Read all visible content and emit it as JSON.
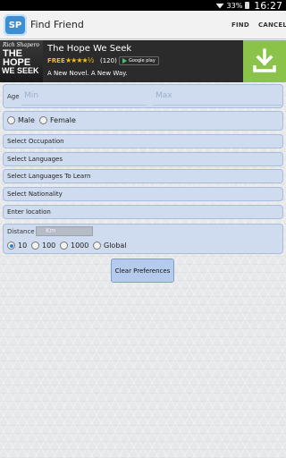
{
  "status_bar": {
    "battery_pct": "33%",
    "time": "16:27"
  },
  "app": {
    "logo_text": "SP",
    "title": "Find Friend"
  },
  "actions": {
    "find": "FIND",
    "cancel": "CANCEL"
  },
  "ad": {
    "cover_author": "Rich Shapero",
    "cover_title_line1": "THE",
    "cover_title_line2": "HOPE",
    "cover_title_line3": "WE SEEK",
    "title": "The Hope We Seek",
    "price": "FREE",
    "stars": "★★★★½",
    "rating_count": "(120)",
    "store": "Google play",
    "tagline": "A New Novel. A New Way.",
    "download_icon": "download-icon"
  },
  "form": {
    "age_label": "Age",
    "age_min_placeholder": "Min",
    "age_max_placeholder": "Max",
    "gender_options": [
      {
        "label": "Male",
        "selected": false
      },
      {
        "label": "Female",
        "selected": false
      }
    ],
    "select_occupation": "Select Occupation",
    "select_languages": "Select Languages",
    "select_languages_to_learn": "Select Languages To Learn",
    "select_nationality": "Select Nationality",
    "enter_location": "Enter location",
    "distance_label": "Distance",
    "distance_unit": "Km",
    "distance_options": [
      {
        "label": "10",
        "selected": true
      },
      {
        "label": "100",
        "selected": false
      },
      {
        "label": "1000",
        "selected": false
      },
      {
        "label": "Global",
        "selected": false
      }
    ],
    "clear_button": "Clear Preferences"
  }
}
